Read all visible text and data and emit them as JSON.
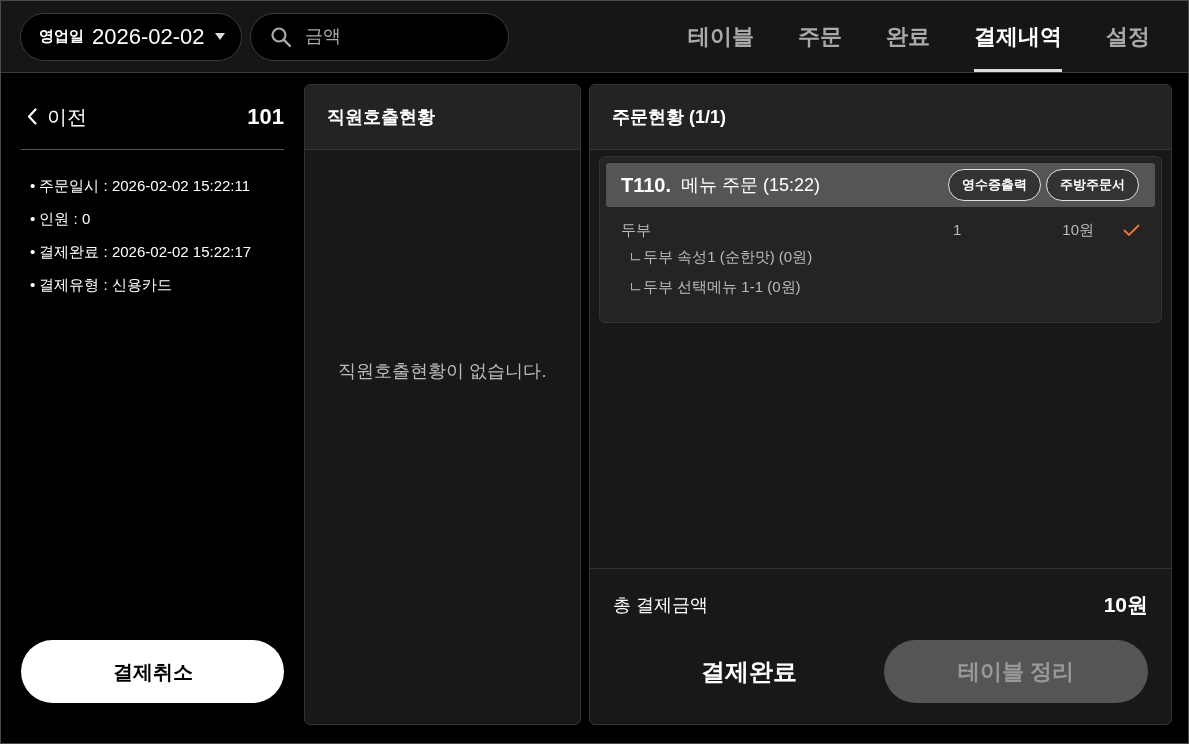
{
  "top_bar": {
    "business_date": {
      "label": "영업일",
      "value": "2026-02-02"
    },
    "search": {
      "placeholder": "금액"
    },
    "tabs": [
      {
        "label": "테이블",
        "selected": false
      },
      {
        "label": "주문",
        "selected": false
      },
      {
        "label": "완료",
        "selected": false
      },
      {
        "label": "결제내역",
        "selected": true
      },
      {
        "label": "설정",
        "selected": false
      }
    ]
  },
  "detail_panel": {
    "back_label": "이전",
    "table_number": "101",
    "info": [
      "• 주문일시 : 2026-02-02 15:22:11",
      "• 인원 : 0",
      "• 결제완료 : 2026-02-02 15:22:17",
      "• 결제유형 : 신용카드"
    ],
    "cancel_button": "결제취소"
  },
  "staff_call_panel": {
    "title": "직원호출현황",
    "empty_message": "직원호출현황이 없습니다."
  },
  "order_panel": {
    "title": "주문현황 (1/1)",
    "orders": [
      {
        "table": "T110.",
        "title": "메뉴 주문 (15:22)",
        "buttons": [
          "영수증출력",
          "주방주문서"
        ],
        "items": [
          {
            "name": "두부",
            "quantity": "1",
            "price": "10원",
            "checked": true,
            "options": [
              "ㄴ두부 속성1 (순한맛) (0원)",
              "ㄴ두부 선택메뉴 1-1 (0원)"
            ]
          }
        ]
      }
    ],
    "total": {
      "label": "총 결제금액",
      "value": "10원"
    },
    "actions": [
      {
        "label": "결제완료",
        "kind": "text",
        "disabled": false
      },
      {
        "label": "테이블 정리",
        "kind": "filled",
        "disabled": true
      }
    ]
  }
}
